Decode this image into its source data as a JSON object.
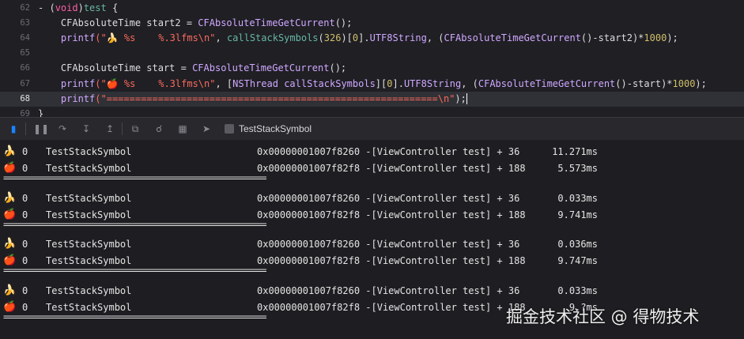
{
  "editor": {
    "current_line": "68",
    "lines": [
      {
        "num": "62",
        "tokens": [
          {
            "t": "- (",
            "c": "plain"
          },
          {
            "t": "void",
            "c": "kw"
          },
          {
            "t": ")",
            "c": "plain"
          },
          {
            "t": "test",
            "c": "fn"
          },
          {
            "t": " {",
            "c": "plain"
          }
        ]
      },
      {
        "num": "63",
        "tokens": [
          {
            "t": "    CFAbsoluteTime start2 = ",
            "c": "plain"
          },
          {
            "t": "CFAbsoluteTimeGetCurrent",
            "c": "ty"
          },
          {
            "t": "();",
            "c": "plain"
          }
        ]
      },
      {
        "num": "64",
        "tokens": [
          {
            "t": "    ",
            "c": "plain"
          },
          {
            "t": "printf",
            "c": "ty"
          },
          {
            "t": "(\"🍌 %s    %.3lfms\\n\"",
            "c": "str"
          },
          {
            "t": ", ",
            "c": "plain"
          },
          {
            "t": "callStackSymbols",
            "c": "fn"
          },
          {
            "t": "(",
            "c": "plain"
          },
          {
            "t": "326",
            "c": "num"
          },
          {
            "t": ")[",
            "c": "plain"
          },
          {
            "t": "0",
            "c": "num"
          },
          {
            "t": "].",
            "c": "plain"
          },
          {
            "t": "UTF8String",
            "c": "ty"
          },
          {
            "t": ", (",
            "c": "plain"
          },
          {
            "t": "CFAbsoluteTimeGetCurrent",
            "c": "ty"
          },
          {
            "t": "()-start2)*",
            "c": "plain"
          },
          {
            "t": "1000",
            "c": "num"
          },
          {
            "t": ");",
            "c": "plain"
          }
        ]
      },
      {
        "num": "65",
        "tokens": []
      },
      {
        "num": "66",
        "tokens": [
          {
            "t": "    CFAbsoluteTime start = ",
            "c": "plain"
          },
          {
            "t": "CFAbsoluteTimeGetCurrent",
            "c": "ty"
          },
          {
            "t": "();",
            "c": "plain"
          }
        ]
      },
      {
        "num": "67",
        "tokens": [
          {
            "t": "    ",
            "c": "plain"
          },
          {
            "t": "printf",
            "c": "ty"
          },
          {
            "t": "(\"🍎 %s    %.3lfms\\n\"",
            "c": "str"
          },
          {
            "t": ", [",
            "c": "plain"
          },
          {
            "t": "NSThread",
            "c": "ty"
          },
          {
            "t": " ",
            "c": "plain"
          },
          {
            "t": "callStackSymbols",
            "c": "ty"
          },
          {
            "t": "][",
            "c": "plain"
          },
          {
            "t": "0",
            "c": "num"
          },
          {
            "t": "].",
            "c": "plain"
          },
          {
            "t": "UTF8String",
            "c": "ty"
          },
          {
            "t": ", (",
            "c": "plain"
          },
          {
            "t": "CFAbsoluteTimeGetCurrent",
            "c": "ty"
          },
          {
            "t": "()-start)*",
            "c": "plain"
          },
          {
            "t": "1000",
            "c": "num"
          },
          {
            "t": ");",
            "c": "plain"
          }
        ]
      },
      {
        "num": "68",
        "tokens": [
          {
            "t": "    ",
            "c": "plain"
          },
          {
            "t": "printf",
            "c": "ty"
          },
          {
            "t": "(\"==========================================================\\n\"",
            "c": "str"
          },
          {
            "t": ");",
            "c": "plain"
          }
        ]
      },
      {
        "num": "69",
        "tokens": [
          {
            "t": "}",
            "c": "plain"
          }
        ]
      }
    ]
  },
  "toolbar": {
    "target_label": "TestStackSymbol",
    "icons": [
      "breakpoint-toggle-icon",
      "pause-icon",
      "step-over-icon",
      "step-into-icon",
      "step-out-icon",
      "debug-view-hierarchy-icon",
      "memory-graph-icon",
      "environment-overrides-icon",
      "simulate-location-icon",
      "target-app-icon"
    ]
  },
  "console": {
    "rows": [
      {
        "kind": "log",
        "emoji": "🍌",
        "idx": "0",
        "module": "TestStackSymbol",
        "symbol": "0x00000001007f8260 -[ViewController test] + 36",
        "time": "11.271ms"
      },
      {
        "kind": "log",
        "emoji": "🍎",
        "idx": "0",
        "module": "TestStackSymbol",
        "symbol": "0x00000001007f82f8 -[ViewController test] + 188",
        "time": "5.573ms"
      },
      {
        "kind": "sep",
        "text": "=========================================================="
      },
      {
        "kind": "log",
        "emoji": "🍌",
        "idx": "0",
        "module": "TestStackSymbol",
        "symbol": "0x00000001007f8260 -[ViewController test] + 36",
        "time": "0.033ms"
      },
      {
        "kind": "log",
        "emoji": "🍎",
        "idx": "0",
        "module": "TestStackSymbol",
        "symbol": "0x00000001007f82f8 -[ViewController test] + 188",
        "time": "9.741ms"
      },
      {
        "kind": "sep",
        "text": "=========================================================="
      },
      {
        "kind": "log",
        "emoji": "🍌",
        "idx": "0",
        "module": "TestStackSymbol",
        "symbol": "0x00000001007f8260 -[ViewController test] + 36",
        "time": "0.036ms"
      },
      {
        "kind": "log",
        "emoji": "🍎",
        "idx": "0",
        "module": "TestStackSymbol",
        "symbol": "0x00000001007f82f8 -[ViewController test] + 188",
        "time": "9.747ms"
      },
      {
        "kind": "sep",
        "text": "=========================================================="
      },
      {
        "kind": "log",
        "emoji": "🍌",
        "idx": "0",
        "module": "TestStackSymbol",
        "symbol": "0x00000001007f8260 -[ViewController test] + 36",
        "time": "0.033ms"
      },
      {
        "kind": "log",
        "emoji": "🍎",
        "idx": "0",
        "module": "TestStackSymbol",
        "symbol": "0x00000001007f82f8 -[ViewController test] + 188",
        "time": "9.?ms"
      },
      {
        "kind": "sep",
        "text": "=========================================================="
      }
    ]
  },
  "watermark": {
    "text": "掘金技术社区 @ 得物技术"
  }
}
